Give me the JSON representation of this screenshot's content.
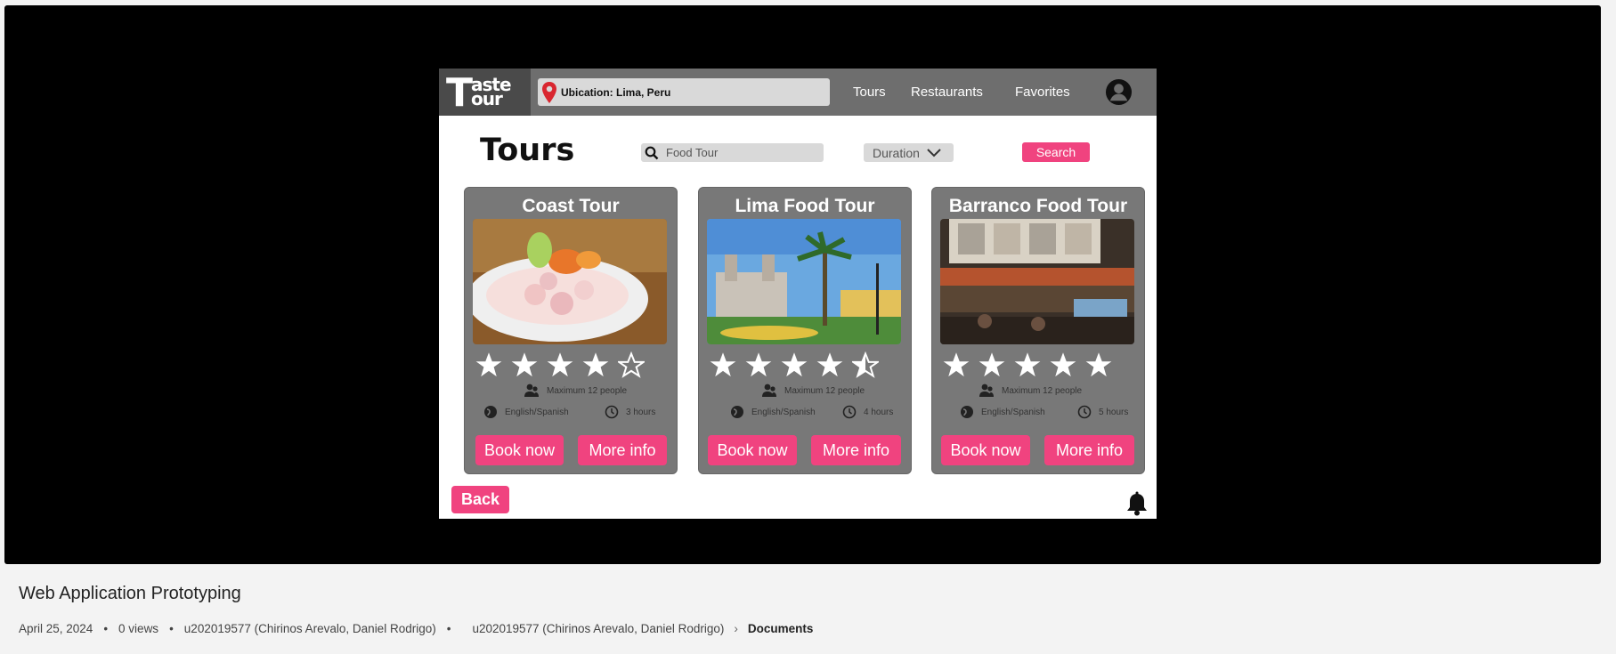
{
  "app": {
    "logo_line1": "aste",
    "logo_line2": "our",
    "logo_big": "T",
    "location": "Ubication: Lima, Peru",
    "nav": [
      "Tours",
      "Restaurants",
      "Favorites"
    ]
  },
  "page": {
    "title": "Tours",
    "search_value": "Food Tour",
    "duration_label": "Duration",
    "search_button": "Search",
    "back_button": "Back"
  },
  "tours": [
    {
      "name": "Coast Tour",
      "rating": 4,
      "capacity": "Maximum 12 people",
      "languages": "English/Spanish",
      "duration": "3 hours",
      "book": "Book now",
      "info": "More info"
    },
    {
      "name": "Lima Food Tour",
      "rating": 4.5,
      "capacity": "Maximum 12 people",
      "languages": "English/Spanish",
      "duration": "4 hours",
      "book": "Book now",
      "info": "More info"
    },
    {
      "name": "Barranco Food Tour",
      "rating": 5,
      "capacity": "Maximum 12 people",
      "languages": "English/Spanish",
      "duration": "5 hours",
      "book": "Book now",
      "info": "More info"
    }
  ],
  "video": {
    "title": "Web Application Prototyping",
    "date": "April 25, 2024",
    "views": "0 views",
    "owner": "u202019577 (Chirinos Arevalo, Daniel Rodrigo)",
    "breadcrumb_root": "u202019577 (Chirinos Arevalo, Daniel Rodrigo)",
    "breadcrumb_leaf": "Documents"
  },
  "colors": {
    "accent": "#f0437f",
    "header": "#6e6e6e",
    "card": "#787878"
  }
}
